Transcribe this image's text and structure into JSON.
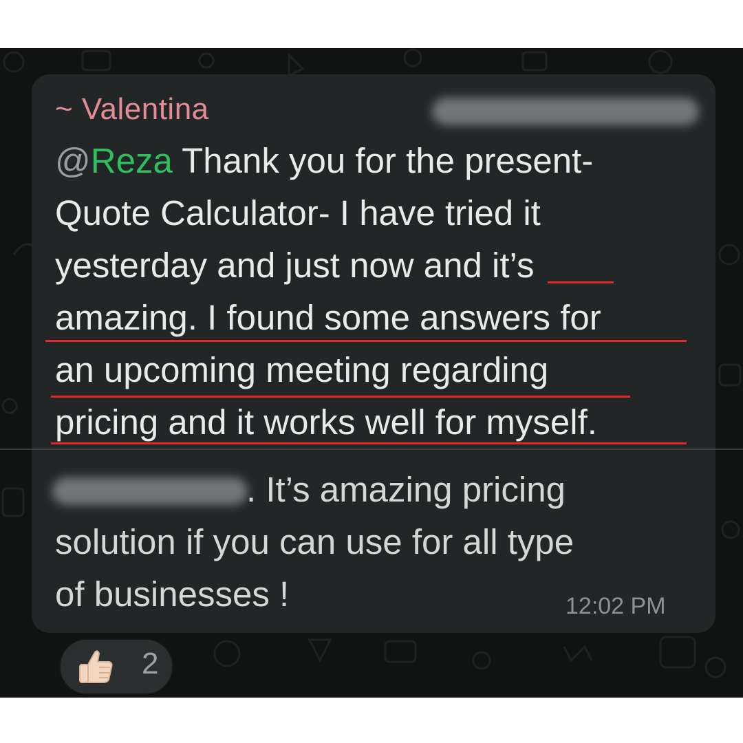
{
  "message": {
    "sender": "~ Valentina",
    "mention_at": "@",
    "mention_name": "Reza",
    "line1_rest": " Thank you for the present-",
    "line2": "Quote Calculator- I have tried it",
    "line3": "yesterday and just now and it’s",
    "line4": "amazing. I found some answers for",
    "line5": "an upcoming meeting regarding",
    "line6": "pricing and it works well for myself.",
    "line7_rest": ".  It’s amazing pricing",
    "line8": "solution if you can use for all type",
    "line9": "of businesses !",
    "time": "12:02 PM"
  },
  "reaction": {
    "icon": "thumbs-up-icon",
    "count": "2"
  },
  "colors": {
    "sender": "#e38c96",
    "mention": "#2fbf5e",
    "highlight_underline": "#e22a2e",
    "bubble": "#222627",
    "background": "#111313"
  }
}
